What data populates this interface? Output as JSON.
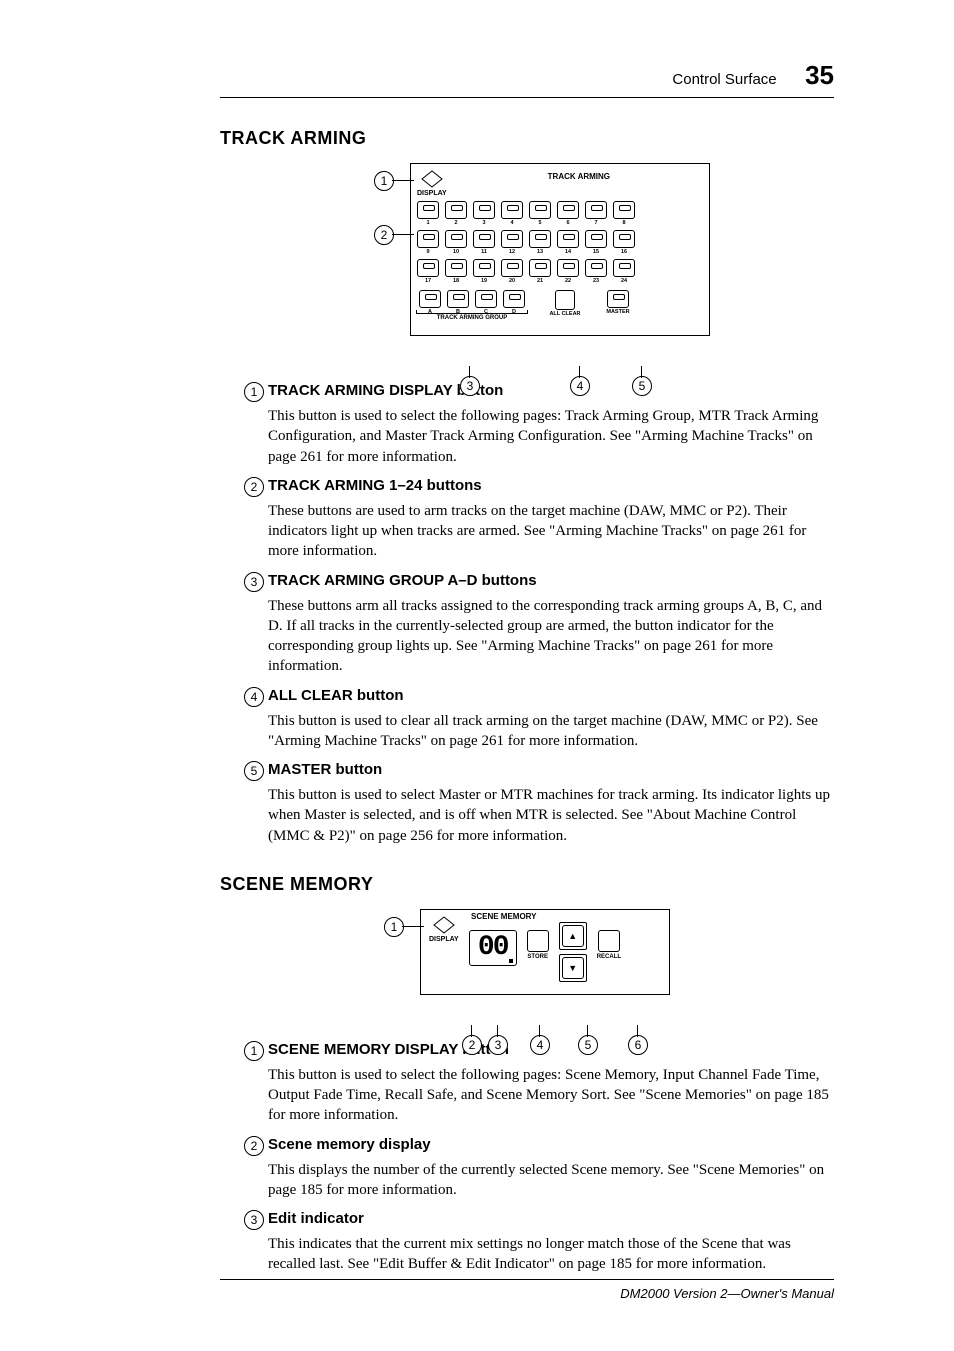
{
  "header": {
    "section": "Control Surface",
    "page_number": "35"
  },
  "section1_title": "TRACK ARMING",
  "ta_fig": {
    "title": "TRACK ARMING",
    "display_label": "DISPLAY",
    "row1": [
      "1",
      "2",
      "3",
      "4",
      "5",
      "6",
      "7",
      "8"
    ],
    "row2": [
      "9",
      "10",
      "11",
      "12",
      "13",
      "14",
      "15",
      "16"
    ],
    "row3": [
      "17",
      "18",
      "19",
      "20",
      "21",
      "22",
      "23",
      "24"
    ],
    "groups": [
      "A",
      "B",
      "C",
      "D"
    ],
    "group_label": "TRACK ARMING GROUP",
    "all_clear": "ALL CLEAR",
    "master": "MASTER",
    "callouts": {
      "c1": "1",
      "c2": "2",
      "c3": "3",
      "c4": "4",
      "c5": "5"
    }
  },
  "ta_items": [
    {
      "num": "1",
      "title": "TRACK ARMING DISPLAY button",
      "body": "This button is used to select the following pages: Track Arming Group, MTR Track Arming Configuration, and Master Track Arming Configuration. See \"Arming Machine Tracks\" on page 261 for more information."
    },
    {
      "num": "2",
      "title": "TRACK ARMING 1–24 buttons",
      "body": "These buttons are used to arm tracks on the target machine (DAW, MMC or P2). Their indicators light up when tracks are armed. See \"Arming Machine Tracks\" on page 261 for more information."
    },
    {
      "num": "3",
      "title": "TRACK ARMING GROUP A–D buttons",
      "body": "These buttons arm all tracks assigned to the corresponding track arming groups A, B, C, and D. If all tracks in the currently-selected group are armed, the button indicator for the corresponding group lights up. See \"Arming Machine Tracks\" on page 261 for more information."
    },
    {
      "num": "4",
      "title": "ALL CLEAR button",
      "body": "This button is used to clear all track arming on the target machine (DAW, MMC or P2). See \"Arming Machine Tracks\" on page 261 for more information."
    },
    {
      "num": "5",
      "title": "MASTER button",
      "body": "This button is used to select Master or MTR machines for track arming. Its indicator lights up when Master is selected, and is off when MTR is selected. See \"About Machine Control (MMC & P2)\" on page 256 for more information."
    }
  ],
  "section2_title": "SCENE MEMORY",
  "sm_fig": {
    "title": "SCENE MEMORY",
    "display_label": "DISPLAY",
    "lcd": "00",
    "store": "STORE",
    "recall": "RECALL",
    "up": "▲",
    "down": "▼",
    "callouts": {
      "c1": "1",
      "c2": "2",
      "c3": "3",
      "c4": "4",
      "c5": "5",
      "c6": "6"
    }
  },
  "sm_items": [
    {
      "num": "1",
      "title": "SCENE MEMORY DISPLAY button",
      "body": "This button is used to select the following pages: Scene Memory, Input Channel Fade Time, Output Fade Time, Recall Safe, and Scene Memory Sort. See \"Scene Memories\" on page 185 for more information."
    },
    {
      "num": "2",
      "title": "Scene memory display",
      "body": "This displays the number of the currently selected Scene memory. See \"Scene Memories\" on page 185 for more information."
    },
    {
      "num": "3",
      "title": "Edit indicator",
      "body": "This indicates that the current mix settings no longer match those of the Scene that was recalled last. See \"Edit Buffer & Edit Indicator\" on page 185 for more information."
    }
  ],
  "footer": "DM2000 Version 2—Owner's Manual"
}
